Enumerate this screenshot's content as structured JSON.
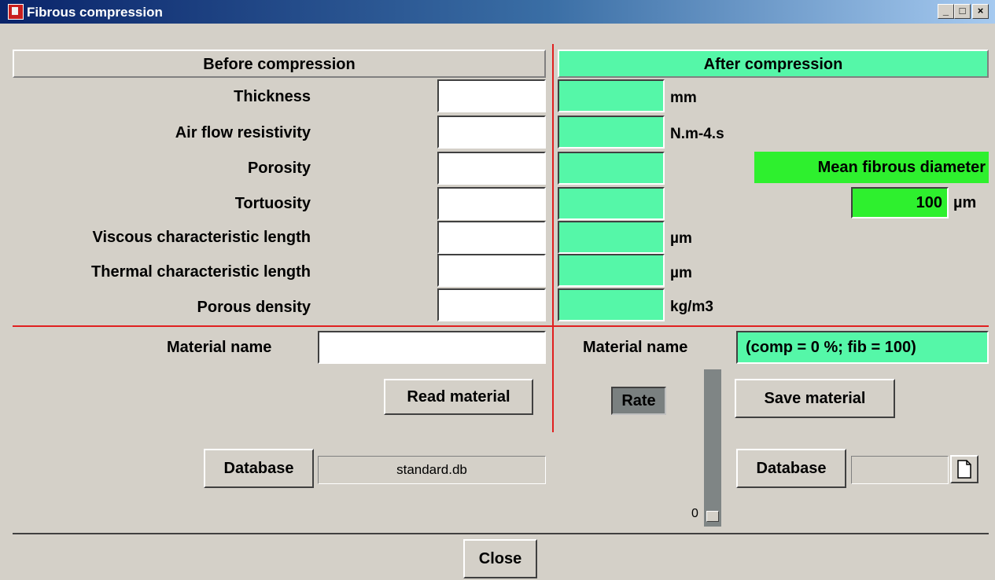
{
  "window": {
    "title": "Fibrous compression",
    "btn_min": "_",
    "btn_max": "□",
    "btn_close": "×"
  },
  "headers": {
    "before": "Before compression",
    "after": "After compression"
  },
  "rows": [
    {
      "label": "Thickness",
      "unit": "mm"
    },
    {
      "label": "Air flow resistivity",
      "unit": "N.m-4.s"
    },
    {
      "label": "Porosity",
      "unit": ""
    },
    {
      "label": "Tortuosity",
      "unit": ""
    },
    {
      "label": "Viscous characteristic length",
      "unit": "µm"
    },
    {
      "label": "Thermal characteristic length",
      "unit": "µm"
    },
    {
      "label": "Porous density",
      "unit": "kg/m3"
    }
  ],
  "mean_fibrous": {
    "label": "Mean fibrous diameter",
    "value": "100",
    "unit": "µm"
  },
  "left": {
    "material_label": "Material name",
    "material_value": "",
    "read_btn": "Read material",
    "database_btn": "Database",
    "database_value": "standard.db"
  },
  "right": {
    "material_label": "Material name",
    "material_value": "(comp = 0 %; fib = 100)",
    "save_btn": "Save material",
    "database_btn": "Database",
    "database_value": ""
  },
  "rate": {
    "label": "Rate",
    "value": "0"
  },
  "close_btn": "Close",
  "colors": {
    "accent_green": "#55f7a8",
    "bright_green": "#2ef02e",
    "divider_red": "#e02020"
  }
}
